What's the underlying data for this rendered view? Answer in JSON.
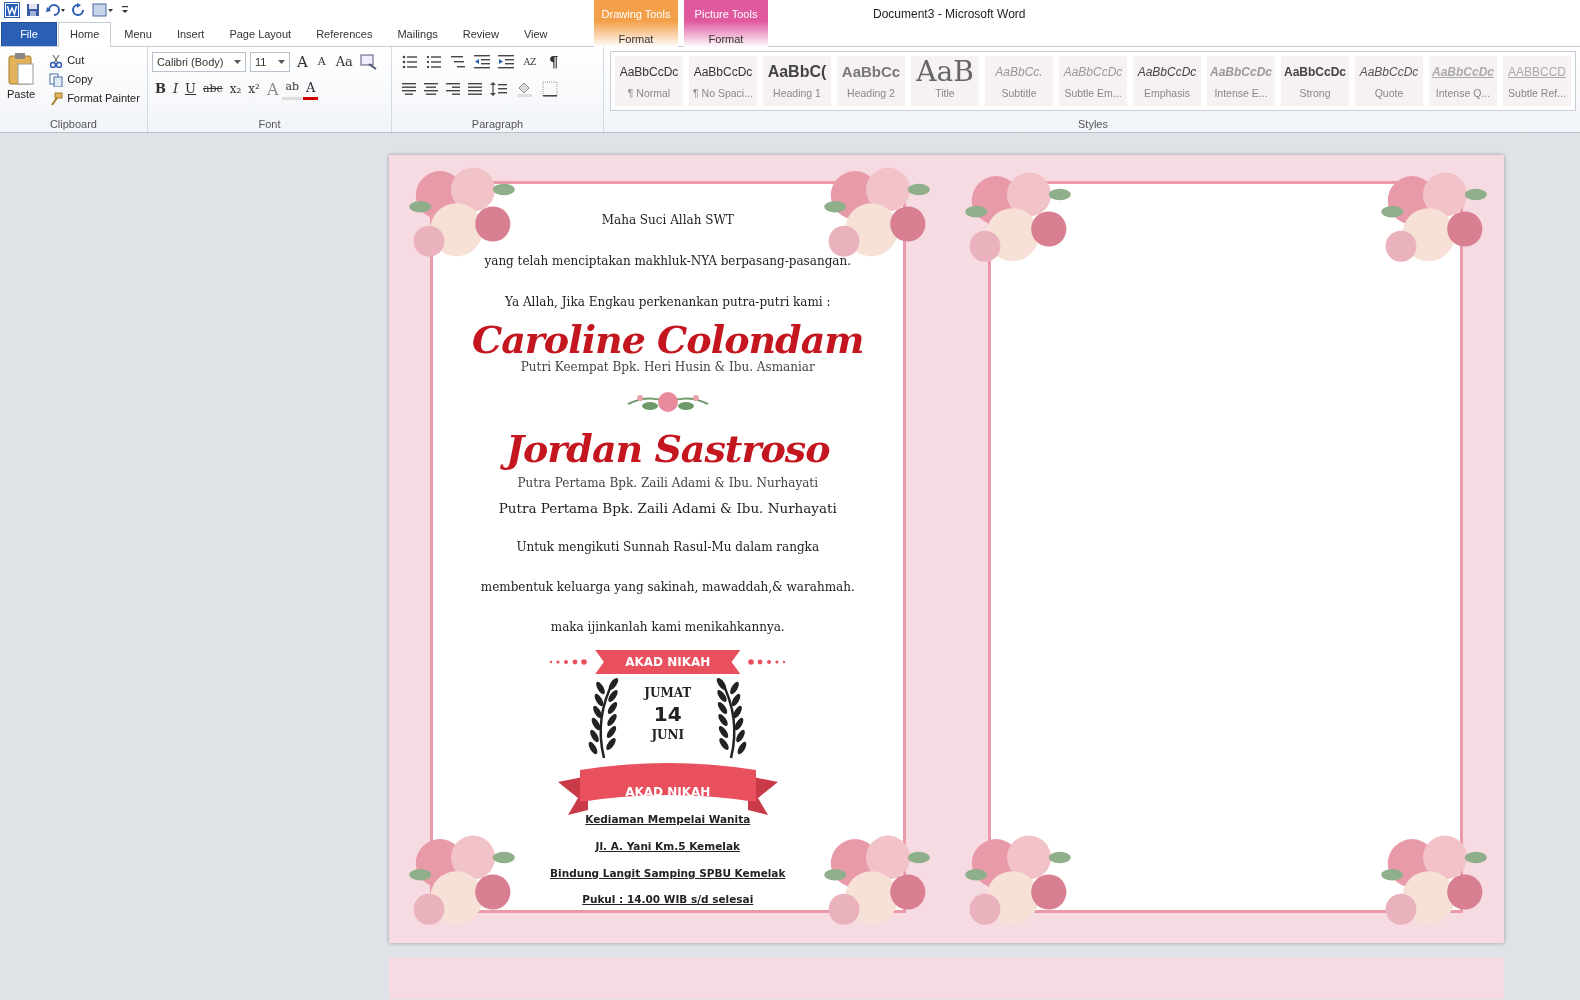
{
  "window": {
    "title": "Document3  -  Microsoft Word"
  },
  "ribbon_tabs": [
    {
      "label": "File",
      "kind": "file",
      "selected": false
    },
    {
      "label": "Home",
      "kind": "plain",
      "selected": true
    },
    {
      "label": "Menu",
      "kind": "plain",
      "selected": false
    },
    {
      "label": "Insert",
      "kind": "plain",
      "selected": false
    },
    {
      "label": "Page Layout",
      "kind": "plain",
      "selected": false
    },
    {
      "label": "References",
      "kind": "plain",
      "selected": false
    },
    {
      "label": "Mailings",
      "kind": "plain",
      "selected": false
    },
    {
      "label": "Review",
      "kind": "plain",
      "selected": false
    },
    {
      "label": "View",
      "kind": "plain",
      "selected": false
    },
    {
      "label": "Format",
      "kind": "contextual",
      "group": "Drawing Tools",
      "color": "#f4a04a",
      "selected": false
    },
    {
      "label": "Format",
      "kind": "contextual",
      "group": "Picture Tools",
      "color": "#e0589e",
      "selected": false
    }
  ],
  "clipboard": {
    "label": "Clipboard",
    "paste": "Paste",
    "cut": "Cut",
    "copy": "Copy",
    "format_painter": "Format Painter"
  },
  "font": {
    "label": "Font",
    "name": "Calibri (Body)",
    "size": "11",
    "row1": [
      {
        "text": "A",
        "kind": "grow"
      },
      {
        "text": "A",
        "kind": "shrink"
      },
      {
        "text": "Aa",
        "kind": "case"
      }
    ],
    "row2": [
      {
        "text": "B",
        "kind": "bold"
      },
      {
        "text": "I",
        "kind": "italic"
      },
      {
        "text": "U",
        "kind": "underline"
      },
      {
        "text": "abc",
        "kind": "strike"
      },
      {
        "text": "x₂",
        "kind": "sub"
      },
      {
        "text": "x²",
        "kind": "sup"
      },
      {
        "text": "A",
        "kind": "effects"
      },
      {
        "text": "ab",
        "kind": "highlight"
      },
      {
        "text": "A",
        "kind": "color"
      }
    ]
  },
  "paragraph": {
    "label": "Paragraph",
    "sort": "AZ",
    "marks": "¶"
  },
  "styles": {
    "label": "Styles",
    "items": [
      {
        "preview": "AaBbCcDc",
        "name": "¶ Normal",
        "kind": "normal"
      },
      {
        "preview": "AaBbCcDc",
        "name": "¶ No Spaci...",
        "kind": "normal"
      },
      {
        "preview": "AaBbC(",
        "name": "Heading 1",
        "kind": "heading1"
      },
      {
        "preview": "AaBbCc",
        "name": "Heading 2",
        "kind": "heading2"
      },
      {
        "preview": "AaB",
        "name": "Title",
        "kind": "title"
      },
      {
        "preview": "AaBbCc.",
        "name": "Subtitle",
        "kind": "subtitle"
      },
      {
        "preview": "AaBbCcDc",
        "name": "Subtle Em...",
        "kind": "subtle"
      },
      {
        "preview": "AaBbCcDc",
        "name": "Emphasis",
        "kind": "emphasis"
      },
      {
        "preview": "AaBbCcDc",
        "name": "Intense E...",
        "kind": "intense"
      },
      {
        "preview": "AaBbCcDc",
        "name": "Strong",
        "kind": "strong"
      },
      {
        "preview": "AaBbCcDc",
        "name": "Quote",
        "kind": "quote"
      },
      {
        "preview": "AaBbCcDc",
        "name": "Intense Q...",
        "kind": "intenseq"
      },
      {
        "preview": "AABBCCD",
        "name": "Subtle Ref...",
        "kind": "subtleref"
      }
    ]
  },
  "invitation": {
    "opening": [
      "Maha Suci  Allah SWT",
      "yang telah menciptakan  makhluk-NYA  berpasang-pasangan.",
      "Ya Allah, Jika  Engkau  perkenankan putra-putri  kami  :"
    ],
    "bride": {
      "name": "Caroline Colondam",
      "parents": "Putri Keempat Bpk. Heri Husin & Ibu. Asmaniar"
    },
    "groom": {
      "name": "Jordan Sastroso",
      "parents": "Putra Pertama Bpk. Zaili Adami  & Ibu. Nurhayati"
    },
    "groom_parents_line": "Putra Pertama Bpk. Zaili Adami  & Ibu. Nurhayati",
    "prayer": [
      "Untuk mengikuti  Sunnah Rasul-Mu  dalam rangka",
      "membentuk  keluarga  yang sakinah,  mawaddah,& warahmah.",
      "maka ijinkanlah  kami  menikahkannya."
    ],
    "event_banner": "AKAD NIKAH",
    "day": "JUMAT",
    "date": "14",
    "month": "JUNI",
    "ribbon": "AKAD NIKAH",
    "details": [
      "Kediaman Mempelai Wanita",
      "Jl. A. Yani Km.5 Kemelak",
      "Bindung  Langit Samping SPBU Kemelak",
      "Pukul : 14.00 WIB s/d selesai"
    ]
  }
}
